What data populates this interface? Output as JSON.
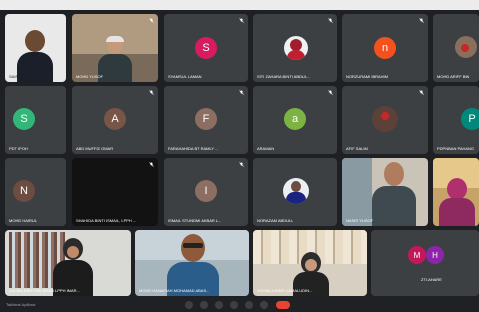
{
  "window": {
    "meeting_title": "Taklimat Aplikasi"
  },
  "participants": [
    {
      "id": "p1",
      "name": "SAIFUL AKMAL ZUHUR",
      "type": "video"
    },
    {
      "id": "p2",
      "name": "Mohd Yusof",
      "type": "video"
    },
    {
      "id": "p3",
      "name": "Syamsul laman",
      "type": "avatar",
      "initial": "S",
      "color": "#d81b60"
    },
    {
      "id": "p4",
      "name": "SITI ZAHARA BINTI ABDUL...",
      "type": "photo"
    },
    {
      "id": "p5",
      "name": "norzurami ibrahim",
      "type": "avatar",
      "initial": "n",
      "color": "#f4511e"
    },
    {
      "id": "p6",
      "name": "MOHD ARIFF BIN",
      "type": "video"
    },
    {
      "id": "p7",
      "name": "PDT Ipoh",
      "type": "avatar",
      "initial": "S",
      "color": "#33b679"
    },
    {
      "id": "p8",
      "name": "Abd Muffiz Omar",
      "type": "avatar",
      "initial": "A",
      "color": "#795548"
    },
    {
      "id": "p9",
      "name": "FARAHAHIDA BT RAMLY ...",
      "type": "avatar",
      "initial": "F",
      "color": "#8d6e63"
    },
    {
      "id": "p10",
      "name": "araman",
      "type": "avatar",
      "initial": "a",
      "color": "#7cb342"
    },
    {
      "id": "p11",
      "name": "afif salim",
      "type": "video"
    },
    {
      "id": "p12",
      "name": "pdpnban pahang",
      "type": "avatar",
      "initial": "P",
      "color": "#00897b"
    },
    {
      "id": "p13",
      "name": "mohd hairul",
      "type": "avatar",
      "initial": "N",
      "color": "#6d4c41"
    },
    {
      "id": "p14",
      "name": "SHAHIDA BINTI ISMAIL, LPPH ...",
      "type": "dark"
    },
    {
      "id": "p15",
      "name": "ISMAIL STUNDMI AKBAR L...",
      "type": "avatar",
      "initial": "I",
      "color": "#8d6e63"
    },
    {
      "id": "p16",
      "name": "Norazam Abdull",
      "type": "photo"
    },
    {
      "id": "p17",
      "name": "Nasir Yusof",
      "type": "video"
    },
    {
      "id": "p18",
      "name": "",
      "type": "video"
    },
    {
      "id": "p19",
      "name": "ZALINA BINTI MD ARON LPPH IMAR...",
      "type": "video"
    },
    {
      "id": "p20",
      "name": "MOHD HANAFIAH MOHAMAD ABAS...",
      "type": "video"
    },
    {
      "id": "p21",
      "name": "SUHAILA BINTI JAMALUDIN...",
      "type": "video"
    },
    {
      "id": "p22",
      "name": "zti.ahare",
      "type": "avatar-pair",
      "initial": "M",
      "initial2": "H",
      "color": "#c2185b",
      "color2": "#8e24aa"
    }
  ],
  "controls": [
    "mic-button",
    "camera-button",
    "captions-button",
    "raise-hand-button",
    "present-button",
    "more-button",
    "end-call-button"
  ]
}
